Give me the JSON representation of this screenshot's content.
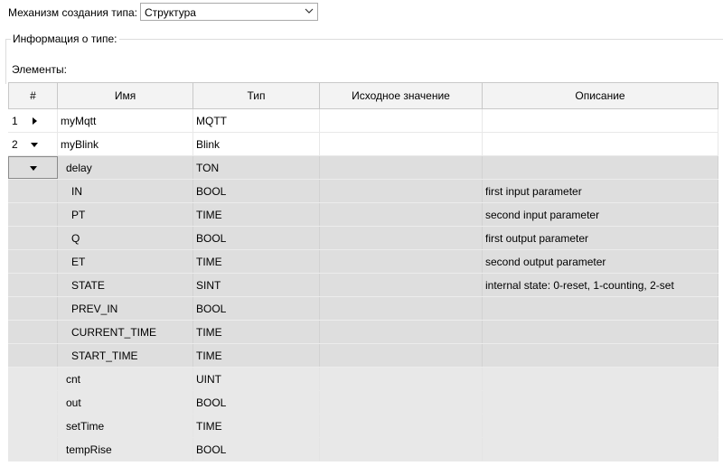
{
  "type_mechanism": {
    "label": "Механизм создания типа:",
    "value": "Структура"
  },
  "type_info": {
    "title": "Информация о типе:"
  },
  "elements": {
    "label": "Элементы:"
  },
  "columns": [
    "#",
    "Имя",
    "Тип",
    "Исходное значение",
    "Описание"
  ],
  "rows": [
    {
      "num": "1",
      "expander": "collapsed",
      "name": "myMqtt",
      "type": "MQTT",
      "initial": "",
      "desc": ""
    },
    {
      "num": "2",
      "expander": "expanded",
      "name": "myBlink",
      "type": "Blink",
      "initial": "",
      "desc": ""
    },
    {
      "num": "",
      "expander": "expanded",
      "name": "delay",
      "type": "TON",
      "initial": "",
      "desc": ""
    },
    {
      "num": "",
      "expander": "",
      "name": "IN",
      "type": "BOOL",
      "initial": "",
      "desc": "first input parameter"
    },
    {
      "num": "",
      "expander": "",
      "name": "PT",
      "type": "TIME",
      "initial": "",
      "desc": "second input parameter"
    },
    {
      "num": "",
      "expander": "",
      "name": "Q",
      "type": "BOOL",
      "initial": "",
      "desc": "first output parameter"
    },
    {
      "num": "",
      "expander": "",
      "name": "ET",
      "type": "TIME",
      "initial": "",
      "desc": "second output parameter"
    },
    {
      "num": "",
      "expander": "",
      "name": "STATE",
      "type": "SINT",
      "initial": "",
      "desc": "internal state: 0-reset, 1-counting, 2-set"
    },
    {
      "num": "",
      "expander": "",
      "name": "PREV_IN",
      "type": "BOOL",
      "initial": "",
      "desc": ""
    },
    {
      "num": "",
      "expander": "",
      "name": "CURRENT_TIME",
      "type": "TIME",
      "initial": "",
      "desc": ""
    },
    {
      "num": "",
      "expander": "",
      "name": "START_TIME",
      "type": "TIME",
      "initial": "",
      "desc": ""
    },
    {
      "num": "",
      "expander": "",
      "name": "cnt",
      "type": "UINT",
      "initial": "",
      "desc": ""
    },
    {
      "num": "",
      "expander": "",
      "name": "out",
      "type": "BOOL",
      "initial": "",
      "desc": ""
    },
    {
      "num": "",
      "expander": "",
      "name": "setTime",
      "type": "TIME",
      "initial": "",
      "desc": ""
    },
    {
      "num": "",
      "expander": "",
      "name": "tempRise",
      "type": "BOOL",
      "initial": "",
      "desc": ""
    }
  ]
}
